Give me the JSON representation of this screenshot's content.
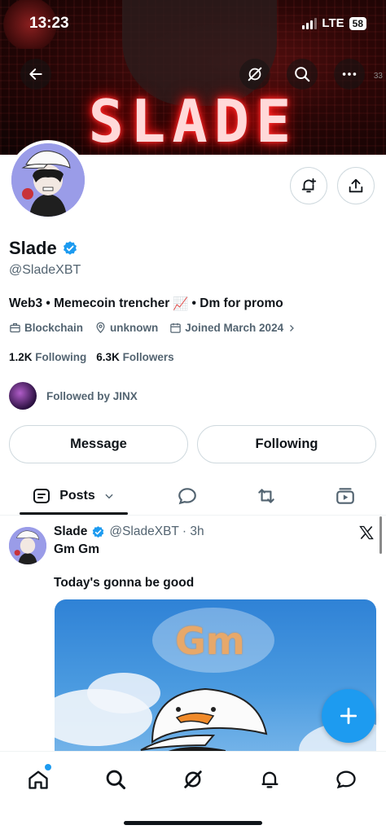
{
  "status": {
    "time": "13:23",
    "network": "LTE",
    "battery": "58"
  },
  "banner": {
    "word": "SLADE",
    "corner": "33"
  },
  "profile": {
    "name": "Slade",
    "handle": "@SladeXBT",
    "bio_prefix": "Web3 • Memecoin trencher",
    "bio_emoji": "📈",
    "bio_suffix": "• Dm for promo",
    "category": "Blockchain",
    "location": "unknown",
    "joined": "Joined March 2024",
    "following_count": "1.2K",
    "following_label": "Following",
    "followers_count": "6.3K",
    "followers_label": "Followers",
    "followed_by": "Followed by JINX"
  },
  "actions": {
    "message": "Message",
    "following": "Following"
  },
  "tabs": {
    "posts": "Posts"
  },
  "post": {
    "author": "Slade",
    "handle_time": "@SladeXBT · 3h",
    "line1": "Gm Gm",
    "line2": "Today's gonna be good",
    "image_text": "Gm"
  },
  "colors": {
    "accent": "#1d9bf0",
    "text": "#0f1419",
    "muted": "#536471"
  }
}
